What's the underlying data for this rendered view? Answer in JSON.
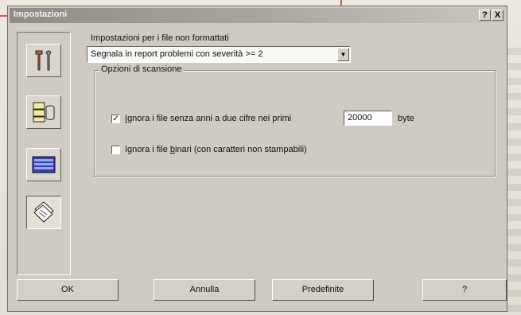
{
  "window": {
    "title": "Impostazioni",
    "help_button": "?",
    "close_button": "X"
  },
  "sidebar": {
    "items": [
      {
        "name": "tools-icon"
      },
      {
        "name": "files-database-icon"
      },
      {
        "name": "report-list-icon"
      },
      {
        "name": "documents-icon"
      }
    ]
  },
  "report": {
    "label": "Impostazioni per i file non formattati",
    "selected_option": "Segnala in report problemi con severità >= 2"
  },
  "scan": {
    "group_title": "Opzioni di scansione",
    "option1": {
      "label_prefix": "Ignora i file senza anni a due cifre nei primi",
      "checked": true
    },
    "bytes_value": "20000",
    "bytes_unit": "byte",
    "option2": {
      "label_pre": "Ignora i file ",
      "label_underline": "b",
      "label_post": "inari (con caratteri non stampabili)",
      "checked": false
    }
  },
  "buttons": {
    "ok": "OK",
    "cancel": "Annulla",
    "defaults": "Predefinite",
    "help": "?"
  }
}
